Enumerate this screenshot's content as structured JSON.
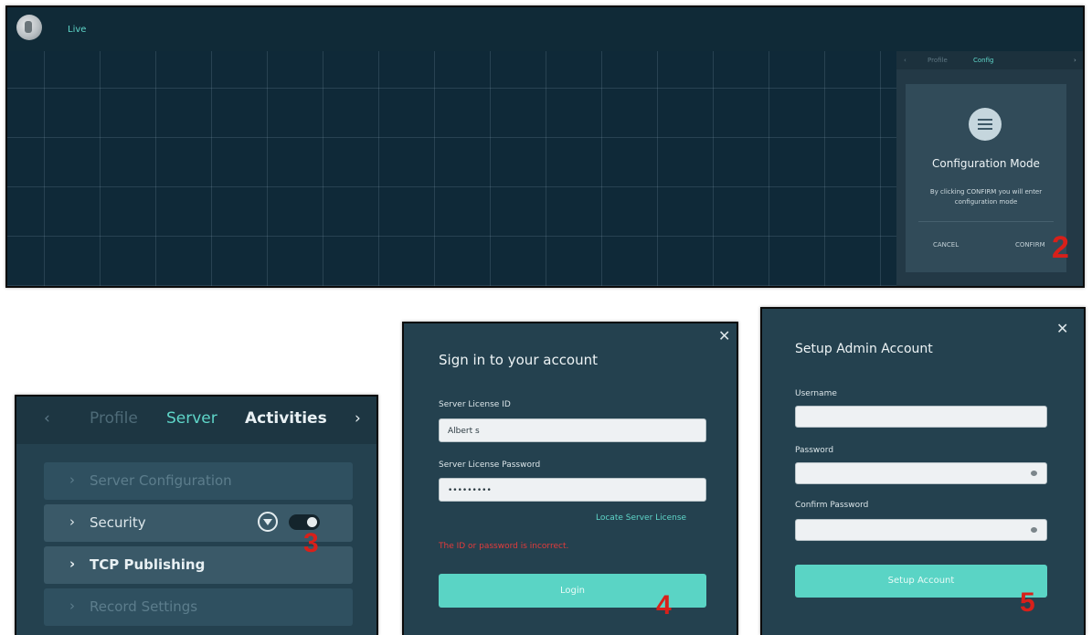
{
  "live_view": {
    "tab_label": "Live",
    "side_tabs": [
      "Profile",
      "Config"
    ],
    "dialog": {
      "title": "Configuration Mode",
      "text": "By clicking CONFIRM you will enter configuration mode",
      "cancel": "CANCEL",
      "confirm": "CONFIRM"
    },
    "step": "2"
  },
  "server_panel": {
    "tabs": [
      "Profile",
      "Server",
      "Activities"
    ],
    "rows": [
      "Server Configuration",
      "Security",
      "TCP Publishing",
      "Record Settings"
    ],
    "step": "3"
  },
  "sign_in": {
    "title": "Sign in to your account",
    "license_id_label": "Server License ID",
    "license_id_value": "Albert s",
    "password_label": "Server License Password",
    "password_value": "•••••••••",
    "locate_link": "Locate Server License",
    "error": "The ID or password is incorrect.",
    "login_button": "Login",
    "step": "4"
  },
  "setup_admin": {
    "title": "Setup Admin Account",
    "username_label": "Username",
    "password_label": "Password",
    "confirm_label": "Confirm Password",
    "button": "Setup Account",
    "step": "5"
  },
  "colors": {
    "accent": "#5ad4c5",
    "error": "#e43b3b",
    "marker": "#d8201a",
    "panel": "#24414f"
  }
}
